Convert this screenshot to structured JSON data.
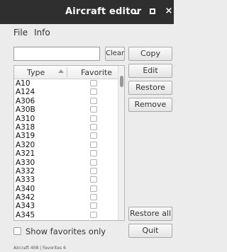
{
  "window": {
    "title": "Aircraft editor",
    "minimize_icon": "minimize-icon",
    "maximize_icon": "maximize-icon",
    "close_icon": "close-icon",
    "close_glyph": "×"
  },
  "menu": {
    "items": [
      "File",
      "Info"
    ]
  },
  "search": {
    "value": "",
    "placeholder": ""
  },
  "buttons": {
    "clear": "Clear",
    "copy": "Copy",
    "edit": "Edit",
    "restore": "Restore",
    "remove": "Remove",
    "restore_all": "Restore all",
    "quit": "Quit"
  },
  "table": {
    "columns": [
      "Type",
      "Favorite"
    ],
    "sort_icon": "sort-ascending-icon",
    "rows": [
      {
        "type": "A10",
        "favorite": false
      },
      {
        "type": "A124",
        "favorite": false
      },
      {
        "type": "A306",
        "favorite": false
      },
      {
        "type": "A30B",
        "favorite": false
      },
      {
        "type": "A310",
        "favorite": false
      },
      {
        "type": "A318",
        "favorite": false
      },
      {
        "type": "A319",
        "favorite": false
      },
      {
        "type": "A320",
        "favorite": false
      },
      {
        "type": "A321",
        "favorite": false
      },
      {
        "type": "A330",
        "favorite": false
      },
      {
        "type": "A332",
        "favorite": false
      },
      {
        "type": "A333",
        "favorite": false
      },
      {
        "type": "A340",
        "favorite": false
      },
      {
        "type": "A342",
        "favorite": false
      },
      {
        "type": "A343",
        "favorite": false
      },
      {
        "type": "A345",
        "favorite": false
      }
    ]
  },
  "show_favorites": {
    "label": "Show favorites only",
    "checked": false
  },
  "status": "Aircraft 408  |  Favorites 6"
}
